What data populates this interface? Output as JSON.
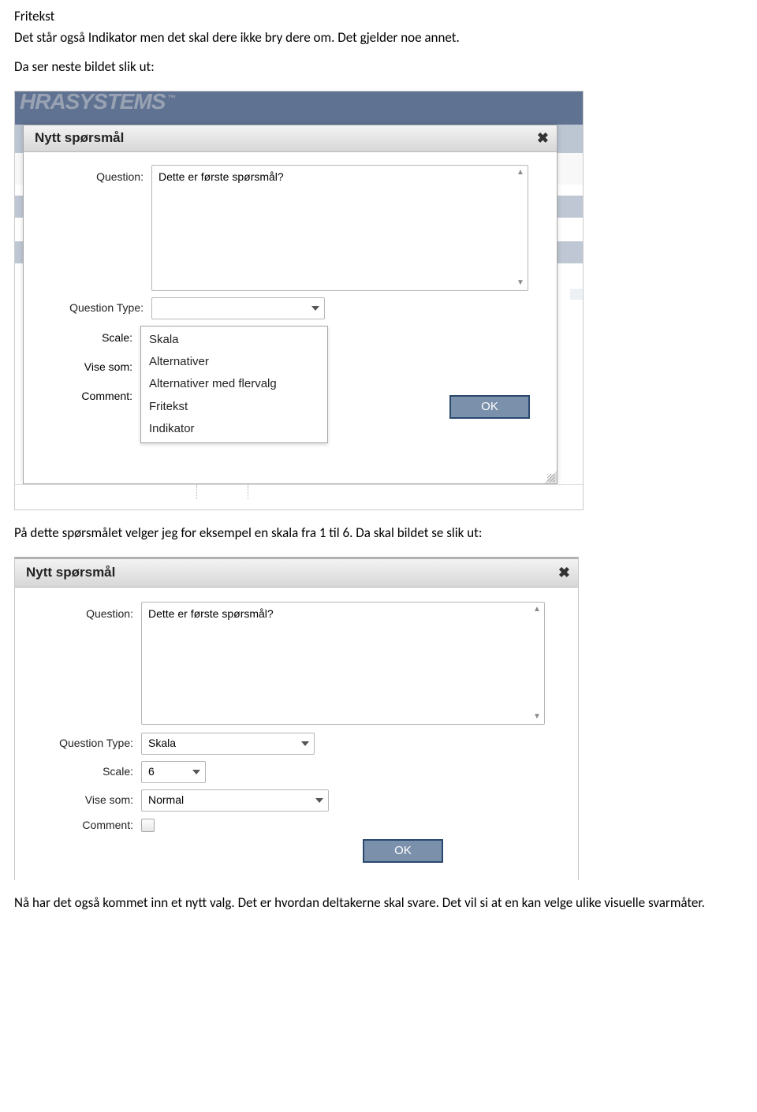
{
  "doc": {
    "line1": "Fritekst",
    "line2": "Det står også Indikator men det skal dere ikke bry dere om. Det gjelder noe annet.",
    "line3": "Da ser neste bildet slik ut:",
    "line4": "På dette spørsmålet velger jeg for eksempel en skala fra 1 til 6. Da skal bildet se slik ut:",
    "line5": "Nå har det også kommet inn et nytt valg. Det er hvordan deltakerne skal svare. Det vil si at en kan velge ulike visuelle svarmåter."
  },
  "brand": "HRASYSTEMS",
  "brand_tm": "™",
  "dialog1": {
    "title": "Nytt spørsmål",
    "labels": {
      "question": "Question:",
      "qtype": "Question Type:",
      "scale": "Scale:",
      "vise": "Vise som:",
      "comment": "Comment:"
    },
    "question_value": "Dette er første spørsmål?",
    "dropdown": [
      "Skala",
      "Alternativer",
      "Alternativer med flervalg",
      "Fritekst",
      "Indikator"
    ],
    "ok": "OK"
  },
  "dialog2": {
    "title": "Nytt spørsmål",
    "labels": {
      "question": "Question:",
      "qtype": "Question Type:",
      "scale": "Scale:",
      "vise": "Vise som:",
      "comment": "Comment:"
    },
    "question_value": "Dette er første spørsmål?",
    "qtype_value": "Skala",
    "scale_value": "6",
    "vise_value": "Normal",
    "ok": "OK"
  }
}
